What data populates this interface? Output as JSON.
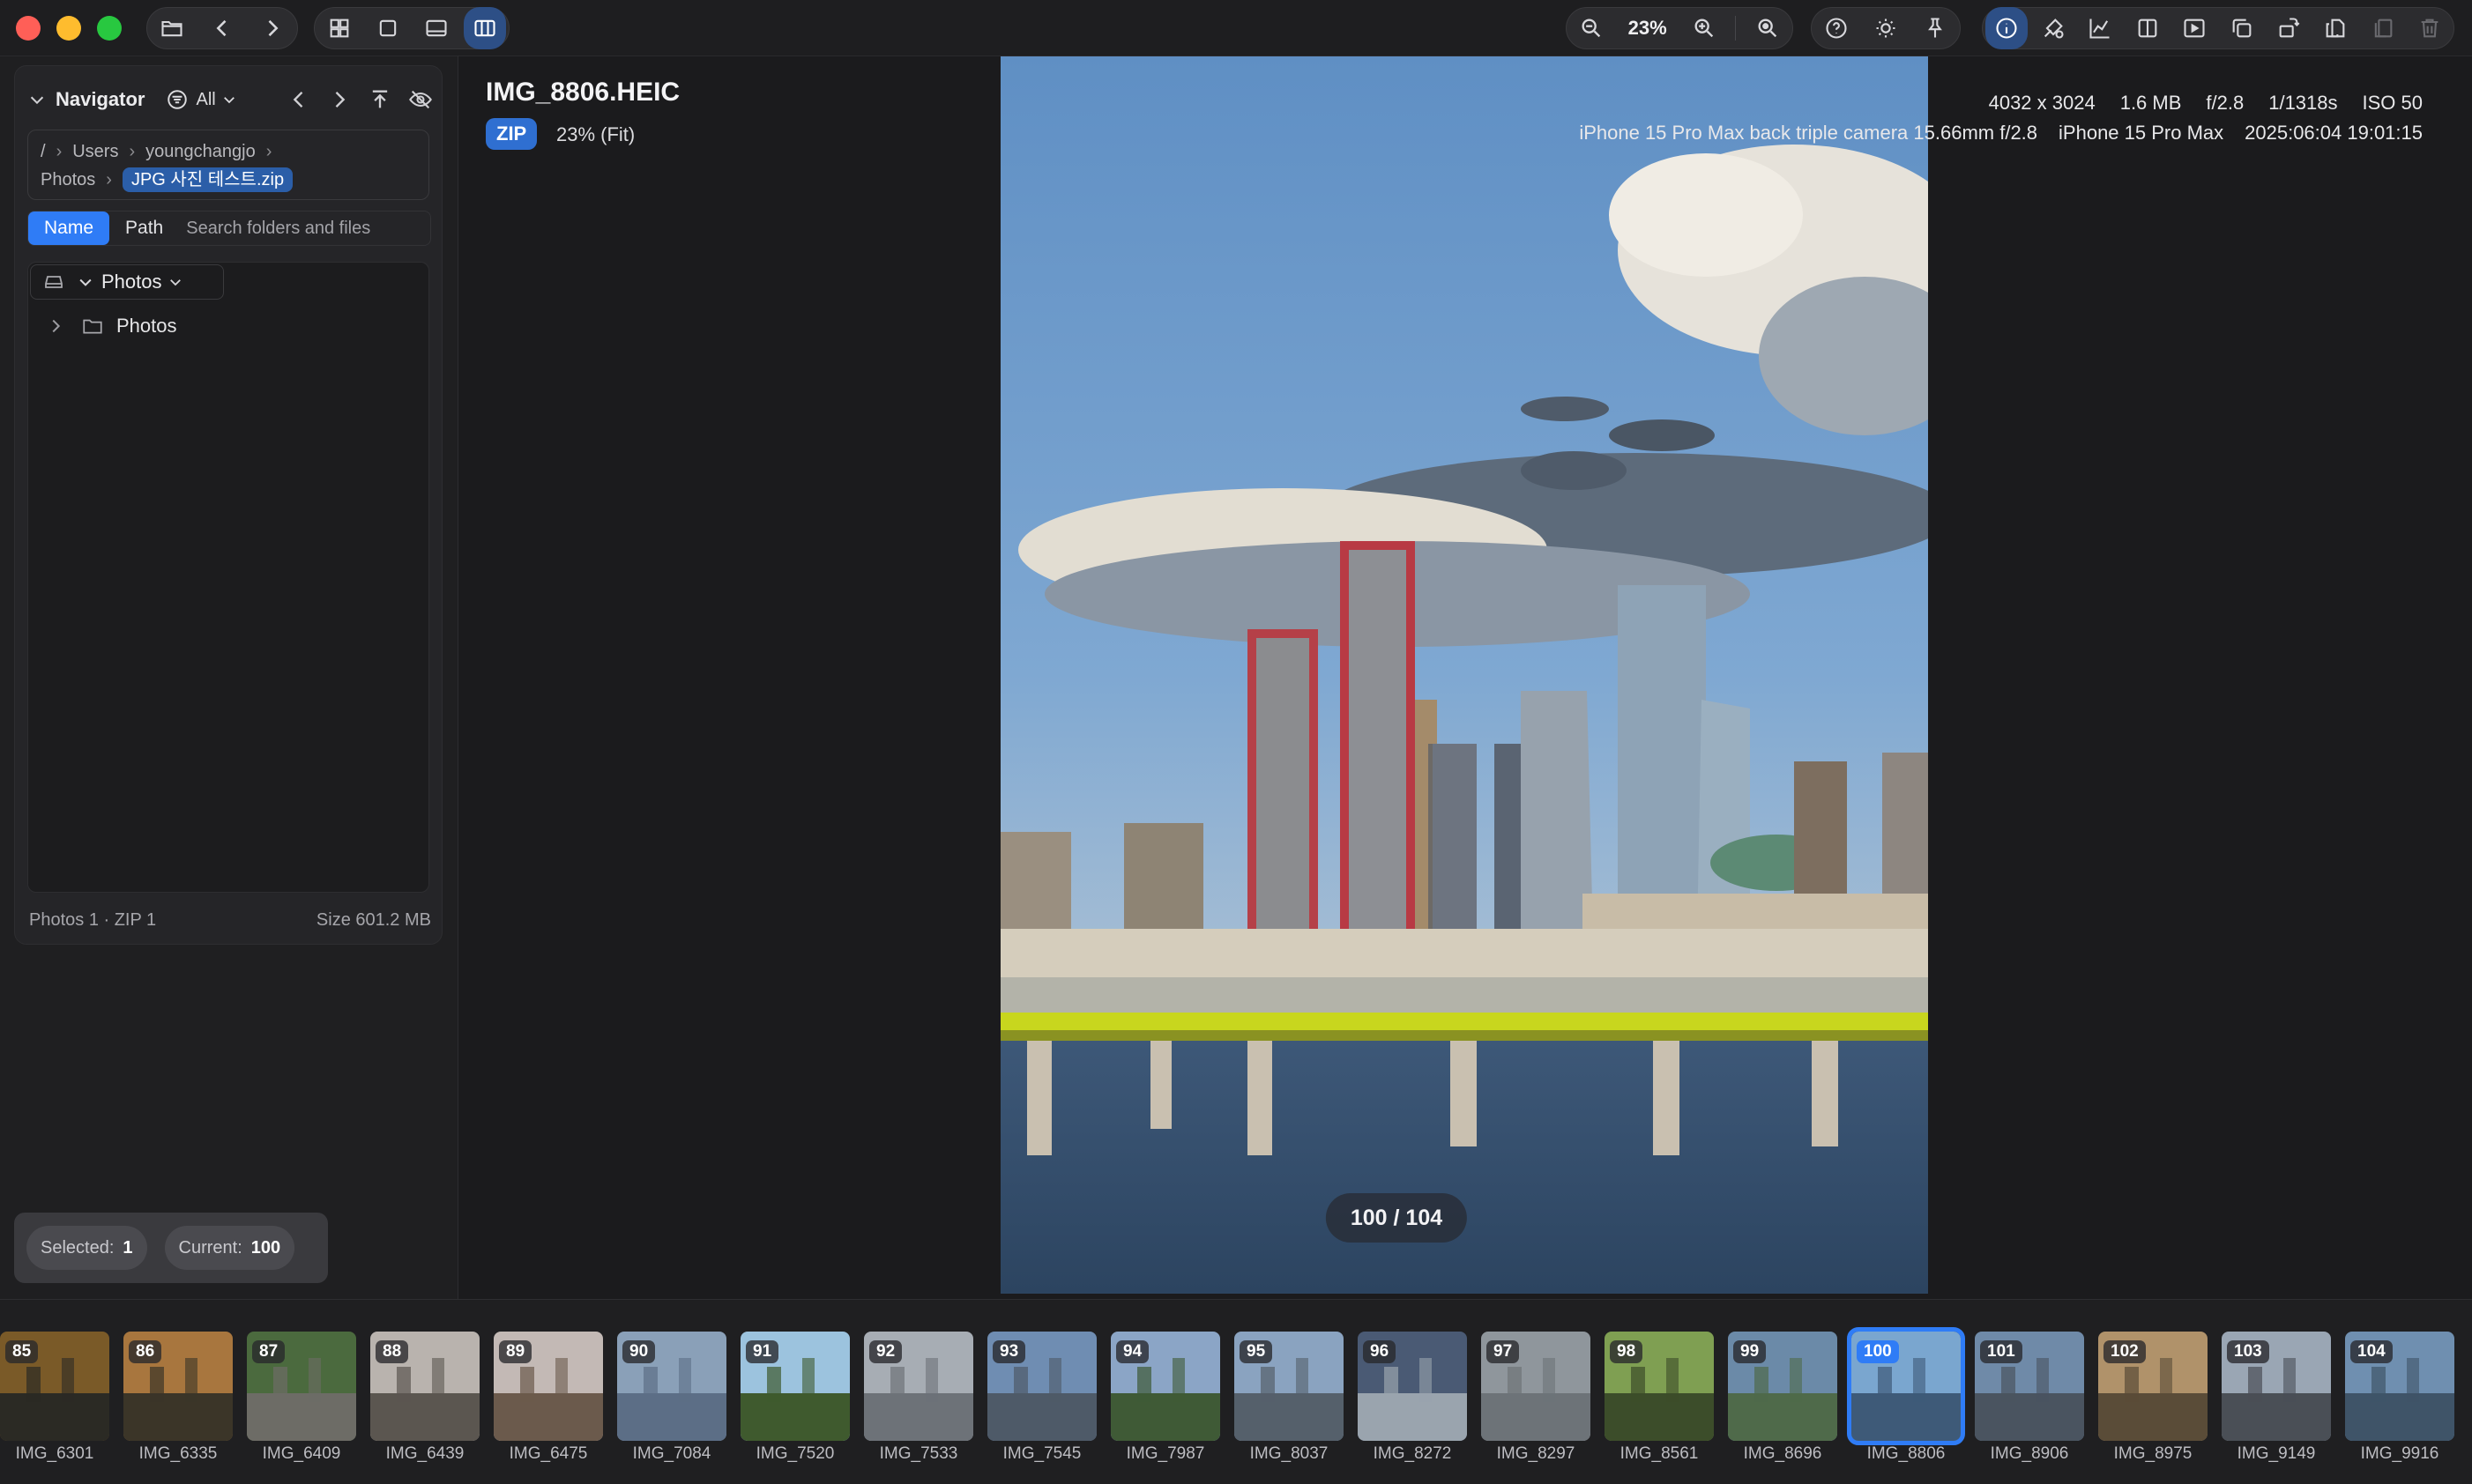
{
  "toolbar": {
    "zoom": "23%",
    "view_modes": [
      "grid-icon",
      "single-icon",
      "filmstrip-icon",
      "columns-icon"
    ],
    "right_tools": [
      "info-icon",
      "adjust-icon",
      "histogram-icon",
      "compare-icon",
      "slideshow-icon",
      "duplicate-icon",
      "rotate-icon",
      "copy-icon",
      "paste-icon",
      "trash-icon"
    ]
  },
  "navigator": {
    "title": "Navigator",
    "filter": "All",
    "path": {
      "root": "/",
      "segments": [
        "Users",
        "youngchangjo",
        "Photos"
      ],
      "current": "JPG 사진 테스트.zip"
    },
    "tabs": [
      "Name",
      "Path"
    ],
    "search_placeholder": "Search folders and files",
    "source": "Photos",
    "tree": [
      {
        "label": "Photos"
      }
    ],
    "footer_left": "Photos 1 · ZIP 1",
    "footer_right": "Size 601.2 MB"
  },
  "status": {
    "selected_label": "Selected:",
    "selected_value": "1",
    "current_label": "Current:",
    "current_value": "100"
  },
  "image": {
    "filename": "IMG_8806.HEIC",
    "badge": "ZIP",
    "zoom_fit": "23% (Fit)",
    "resolution": "4032 x 3024",
    "filesize": "1.6 MB",
    "aperture": "f/2.8",
    "shutter": "1/1318s",
    "iso": "ISO 50",
    "lens": "iPhone 15 Pro Max back triple camera 15.66mm f/2.8",
    "camera": "iPhone 15 Pro Max",
    "datetime": "2025:06:04 19:01:15",
    "counter": "100 / 104"
  },
  "filmstrip": [
    {
      "num": "85",
      "name": "IMG_6301",
      "c1": "#7a5a28",
      "c2": "#2b2a24"
    },
    {
      "num": "86",
      "name": "IMG_6335",
      "c1": "#a8763e",
      "c2": "#3b3528"
    },
    {
      "num": "87",
      "name": "IMG_6409",
      "c1": "#4b6a3e",
      "c2": "#6d6c66"
    },
    {
      "num": "88",
      "name": "IMG_6439",
      "c1": "#b9b3ae",
      "c2": "#5b5650"
    },
    {
      "num": "89",
      "name": "IMG_6475",
      "c1": "#c3b9b5",
      "c2": "#6b5a4c"
    },
    {
      "num": "90",
      "name": "IMG_7084",
      "c1": "#8aa0b8",
      "c2": "#5c6e86"
    },
    {
      "num": "91",
      "name": "IMG_7520",
      "c1": "#9cc3de",
      "c2": "#3f5a2e"
    },
    {
      "num": "92",
      "name": "IMG_7533",
      "c1": "#a7adb4",
      "c2": "#6d7278"
    },
    {
      "num": "93",
      "name": "IMG_7545",
      "c1": "#6f8db2",
      "c2": "#4e5a68"
    },
    {
      "num": "94",
      "name": "IMG_7987",
      "c1": "#8ba5c6",
      "c2": "#3f5a36"
    },
    {
      "num": "95",
      "name": "IMG_8037",
      "c1": "#8aa3c0",
      "c2": "#55606b"
    },
    {
      "num": "96",
      "name": "IMG_8272",
      "c1": "#4a5a74",
      "c2": "#9aa4ae"
    },
    {
      "num": "97",
      "name": "IMG_8297",
      "c1": "#8f969c",
      "c2": "#6d7378"
    },
    {
      "num": "98",
      "name": "IMG_8561",
      "c1": "#7f9f52",
      "c2": "#3c4d2a"
    },
    {
      "num": "99",
      "name": "IMG_8696",
      "c1": "#6b8aa8",
      "c2": "#4f6a4a"
    },
    {
      "num": "100",
      "name": "IMG_8806",
      "c1": "#7aa6cf",
      "c2": "#3e5a78",
      "selected": true
    },
    {
      "num": "101",
      "name": "IMG_8906",
      "c1": "#6f8aa8",
      "c2": "#4a5460"
    },
    {
      "num": "102",
      "name": "IMG_8975",
      "c1": "#b0926a",
      "c2": "#5a4c38"
    },
    {
      "num": "103",
      "name": "IMG_9149",
      "c1": "#9aa6b4",
      "c2": "#4a4f56"
    },
    {
      "num": "104",
      "name": "IMG_9916",
      "c1": "#6f8fb0",
      "c2": "#3f5468"
    }
  ],
  "colors": {
    "accent": "#2f7cf6",
    "zip_chip": "#2b5ea8",
    "selected_outline": "#2f7cf6"
  }
}
